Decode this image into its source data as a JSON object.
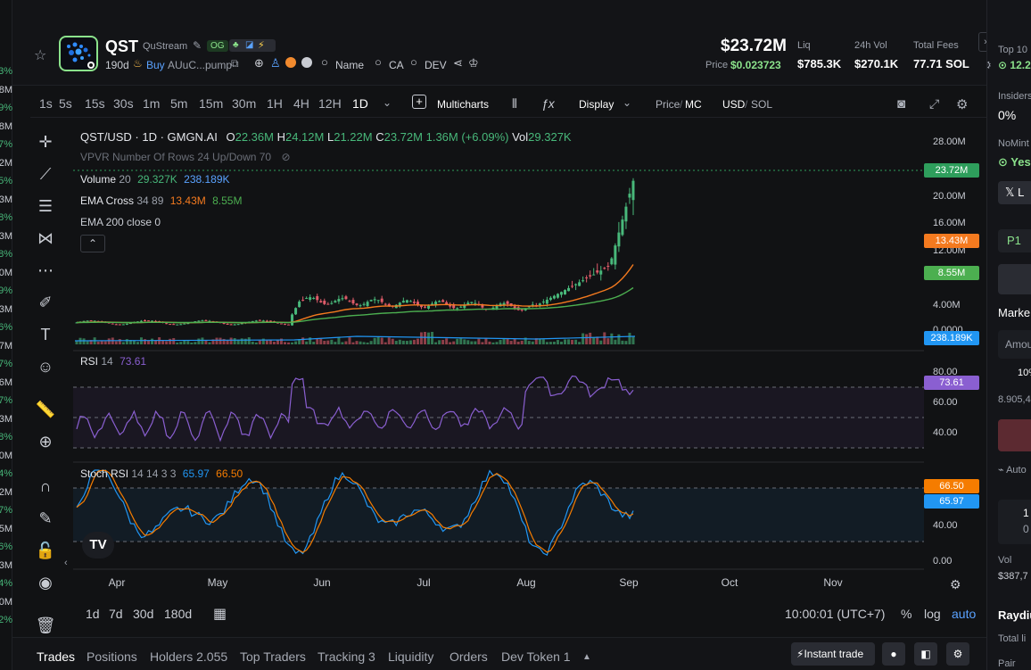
{
  "token": {
    "symbol": "QST",
    "name": "QuStream",
    "og_badge": "OG",
    "age": "190d",
    "buy_label": "Buy",
    "contract": "AUuC...pump",
    "links": [
      "Name",
      "CA",
      "DEV"
    ]
  },
  "stats": {
    "market_cap": "$23.72M",
    "price_label": "Price",
    "price": "$0.023723",
    "liq_label": "Liq",
    "liq": "$785.3K",
    "vol_label": "24h Vol",
    "vol": "$270.1K",
    "fees_label": "Total Fees",
    "fees": "77.71 SOL"
  },
  "toolbar": {
    "intervals": [
      "1s",
      "5s",
      "15s",
      "30s",
      "1m",
      "5m",
      "15m",
      "30m",
      "1H",
      "4H",
      "12H",
      "1D"
    ],
    "active_interval": "1D",
    "multicharts": "Multicharts",
    "display": "Display",
    "price_label": "Price",
    "mc_label": "MC",
    "usd_label": "USD",
    "sol_label": "SOL"
  },
  "legend": {
    "title": "QST/USD · 1D · GMGN.AI",
    "o_label": "O",
    "o": "22.36M",
    "h_label": "H",
    "h": "24.12M",
    "l_label": "L",
    "l": "21.22M",
    "c_label": "C",
    "c": "23.72M",
    "change": "1.36M (+6.09%)",
    "vol_label": "Vol",
    "vol": "29.327K",
    "vpvr": "VPVR Number Of Rows 24 Up/Down 70",
    "volume_label": "Volume",
    "volume_len": "20",
    "volume_v1": "29.327K",
    "volume_v2": "238.189K",
    "ema_cross_label": "EMA Cross",
    "ema_cross_params": "34 89",
    "ema_cross_v1": "13.43M",
    "ema_cross_v2": "8.55M",
    "ema200": "EMA 200 close 0",
    "rsi_label": "RSI",
    "rsi_len": "14",
    "rsi_val": "73.61",
    "stoch_label": "Stoch RSI",
    "stoch_params": "14 14 3 3",
    "stoch_k": "65.97",
    "stoch_d": "66.50"
  },
  "tags": {
    "price": "23.72M",
    "ema34": "13.43M",
    "ema89": "8.55M",
    "volume": "238.189K",
    "rsi": "73.61",
    "stoch_d": "66.50",
    "stoch_k": "65.97"
  },
  "colors": {
    "up": "#48b87a",
    "down": "#e05c6a",
    "ema34": "#f47a1f",
    "ema89": "#4caf50",
    "rsi": "#8a5fd1",
    "stoch_k": "#2196f3",
    "stoch_d": "#f57c00",
    "price_tag": "#2e9e5c",
    "accent": "#8be28b"
  },
  "chart_data": {
    "type": "candlestick",
    "x_ticks": [
      "Apr",
      "May",
      "Jun",
      "Jul",
      "Aug",
      "Sep",
      "Oct",
      "Nov"
    ],
    "price_ticks": [
      "28.00M",
      "20.00M",
      "16.00M",
      "12.00M",
      "4.00M",
      "0.0000"
    ],
    "rsi_ticks": [
      "80.00",
      "60.00",
      "40.00"
    ],
    "stoch_ticks": [
      "40.00",
      "0.00"
    ],
    "ylim_price_millions": [
      0,
      28
    ],
    "rsi_levels": [
      70,
      50,
      30
    ],
    "stoch_levels": [
      80,
      20
    ],
    "close_millions_approx": [
      1.2,
      1.5,
      1.4,
      1.3,
      1.2,
      1.1,
      1.0,
      1.1,
      1.2,
      1.3,
      1.5,
      1.7,
      5.5,
      4.8,
      4.6,
      4.5,
      4.4,
      4.2,
      4.0,
      3.8,
      3.6,
      3.5,
      3.4,
      3.3,
      3.2,
      3.4,
      5.0,
      6.5,
      7.0,
      8.0,
      9.5,
      11.0,
      17.0,
      23.72
    ],
    "last_close": "23.72M"
  },
  "timebar": {
    "ranges": [
      "1d",
      "7d",
      "30d",
      "180d"
    ],
    "clock": "10:00:01 (UTC+7)",
    "percent": "%",
    "log": "log",
    "auto": "auto"
  },
  "tabs": {
    "trades": "Trades",
    "positions": "Positions",
    "holders": "Holders 2.055",
    "top_traders": "Top Traders",
    "tracking": "Tracking 3",
    "liquidity": "Liquidity",
    "orders": "Orders",
    "dev_token": "Dev Token 1",
    "instant_trade": "Instant trade"
  },
  "right_panel": {
    "top10": "Top 10",
    "top10_val": "12.2",
    "insiders": "Insiders",
    "insiders_val": "0%",
    "nomint": "NoMint",
    "nomint_val": "Yes",
    "x_btn": "L",
    "p1": "P1",
    "market": "Marke",
    "amount": "Amou",
    "pct": "10%",
    "bal": "8.905,4",
    "auto": "Auto",
    "one": "1",
    "zero": "0",
    "vol": "Vol",
    "vol_val": "$387,7",
    "raydium": "Raydiu",
    "total_liq": "Total li",
    "pair": "Pair"
  },
  "left_strip": [
    "3%",
    "8M",
    "9%",
    "8M",
    "7%",
    "2M",
    "5%",
    "3M",
    "8%",
    "3M",
    "8%",
    "0M",
    "9%",
    "3M",
    "6%",
    "7M",
    "7%",
    "6M",
    "7%",
    "3M",
    "8%",
    "0M",
    "4%",
    "2M",
    "7%",
    "5M",
    "6%",
    "3M",
    "4%",
    "0M",
    "2%"
  ]
}
